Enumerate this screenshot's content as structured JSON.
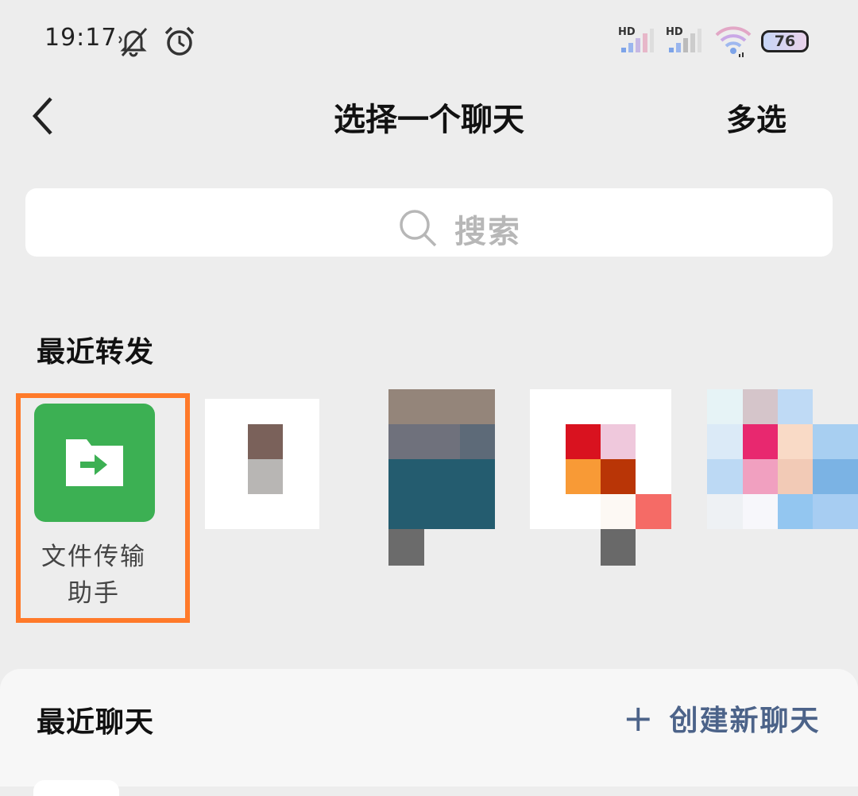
{
  "status_bar": {
    "time": "19:17",
    "battery": "76",
    "icons": [
      "mute-icon",
      "alarm-icon",
      "signal-hd-icon",
      "signal-hd-icon",
      "wifi-icon",
      "battery-icon"
    ],
    "signal_label": "HD"
  },
  "nav": {
    "back_icon": "chevron-left-icon",
    "title": "选择一个聊天",
    "multi_select": "多选"
  },
  "search": {
    "placeholder": "搜索",
    "icon": "search-icon"
  },
  "recent_forward": {
    "title": "最近转发",
    "contacts": [
      {
        "name": "文件传输助手",
        "line1": "文件传输",
        "line2": "助手",
        "icon": "folder-transfer-icon",
        "color": "#3cb053",
        "highlighted": true
      },
      {
        "name": "",
        "blurred": true
      },
      {
        "name": "",
        "blurred": true
      },
      {
        "name": "",
        "blurred": true
      },
      {
        "name": "",
        "blurred": true
      }
    ]
  },
  "recent_chats": {
    "title": "最近聊天",
    "create_label": "创建新聊天",
    "create_icon": "plus-icon"
  },
  "colors": {
    "background": "#ededed",
    "accent_green": "#3cb053",
    "highlight_orange": "#ff7a2a",
    "link_blue": "#4c6389"
  }
}
